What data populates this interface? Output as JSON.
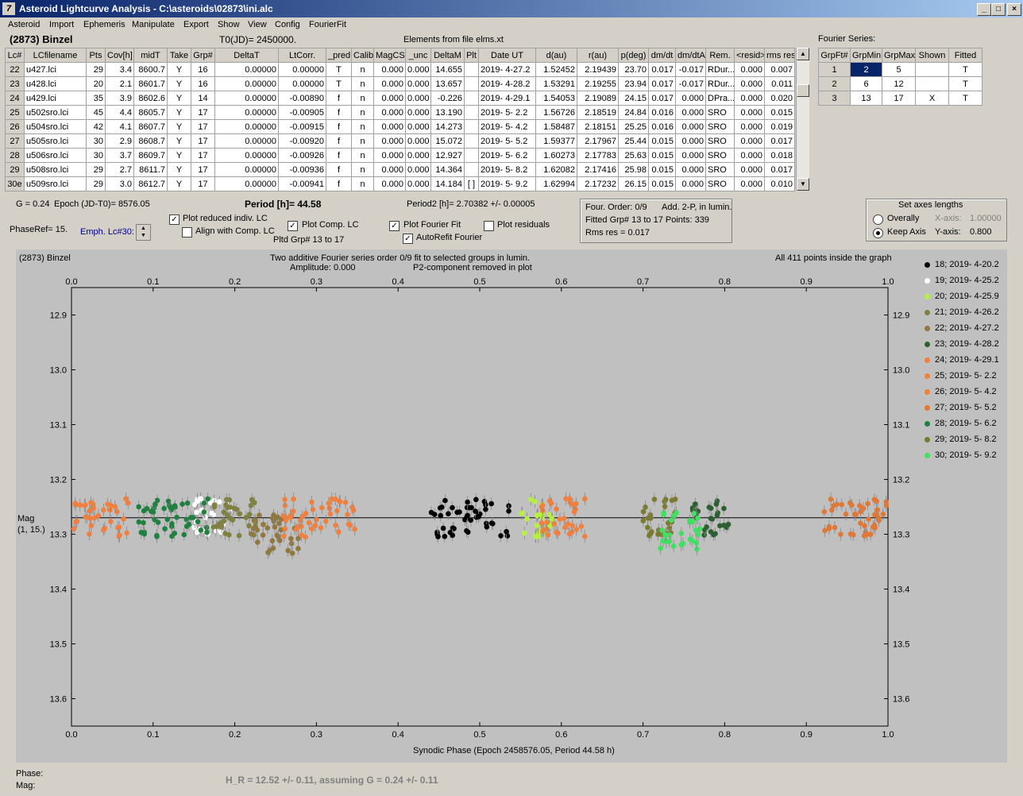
{
  "window": {
    "title": "Asteroid Lightcurve Analysis - C:\\asteroids\\02873\\ini.alc",
    "app_icon": "7"
  },
  "menu": [
    "Asteroid",
    "Import",
    "Ephemeris",
    "Manipulate",
    "Export",
    "Show",
    "View",
    "Config",
    "FourierFit"
  ],
  "header": {
    "asteroid": "(2873) Binzel",
    "t0": "T0(JD)= 2450000.",
    "elements": "Elements from file elms.xt",
    "fourier_label": "Fourier Series:"
  },
  "table": {
    "columns": [
      "Lc#",
      "LCfilename",
      "Pts",
      "Cov[h]",
      "midT",
      "Take",
      "Grp#",
      "DeltaT",
      "LtCorr.",
      "_pred.",
      "Calib.",
      "MagCS",
      "_unc",
      "DeltaM",
      "Plt",
      "Date UT",
      "d(au)",
      "r(au)",
      "p(deg)",
      "dm/dt",
      "dm/dtA",
      "Rem.",
      "<resid>",
      "rms res"
    ],
    "rows": [
      [
        "22",
        "u427.lci",
        "29",
        "3.4",
        "8600.7",
        "Y",
        "16",
        "0.00000",
        "0.00000",
        "T",
        "n",
        "0.000",
        "0.000",
        "14.655",
        "",
        "2019- 4-27.2",
        "1.52452",
        "2.19439",
        "23.70",
        "0.017",
        "-0.017",
        "RDur...",
        "0.000",
        "0.007"
      ],
      [
        "23",
        "u428.lci",
        "20",
        "2.1",
        "8601.7",
        "Y",
        "16",
        "0.00000",
        "0.00000",
        "T",
        "n",
        "0.000",
        "0.000",
        "13.657",
        "",
        "2019- 4-28.2",
        "1.53291",
        "2.19255",
        "23.94",
        "0.017",
        "-0.017",
        "RDur...",
        "0.000",
        "0.011"
      ],
      [
        "24",
        "u429.lci",
        "35",
        "3.9",
        "8602.6",
        "Y",
        "14",
        "0.00000",
        "-0.00890",
        "f",
        "n",
        "0.000",
        "0.000",
        "-0.226",
        "",
        "2019- 4-29.1",
        "1.54053",
        "2.19089",
        "24.15",
        "0.017",
        "0.000",
        "DPra...",
        "0.000",
        "0.020"
      ],
      [
        "25",
        "u502sro.lci",
        "45",
        "4.4",
        "8605.7",
        "Y",
        "17",
        "0.00000",
        "-0.00905",
        "f",
        "n",
        "0.000",
        "0.000",
        "13.190",
        "",
        "2019- 5- 2.2",
        "1.56726",
        "2.18519",
        "24.84",
        "0.016",
        "0.000",
        "SRO",
        "0.000",
        "0.015"
      ],
      [
        "26",
        "u504sro.lci",
        "42",
        "4.1",
        "8607.7",
        "Y",
        "17",
        "0.00000",
        "-0.00915",
        "f",
        "n",
        "0.000",
        "0.000",
        "14.273",
        "",
        "2019- 5- 4.2",
        "1.58487",
        "2.18151",
        "25.25",
        "0.016",
        "0.000",
        "SRO",
        "0.000",
        "0.019"
      ],
      [
        "27",
        "u505sro.lci",
        "30",
        "2.9",
        "8608.7",
        "Y",
        "17",
        "0.00000",
        "-0.00920",
        "f",
        "n",
        "0.000",
        "0.000",
        "15.072",
        "",
        "2019- 5- 5.2",
        "1.59377",
        "2.17967",
        "25.44",
        "0.015",
        "0.000",
        "SRO",
        "0.000",
        "0.017"
      ],
      [
        "28",
        "u506sro.lci",
        "30",
        "3.7",
        "8609.7",
        "Y",
        "17",
        "0.00000",
        "-0.00926",
        "f",
        "n",
        "0.000",
        "0.000",
        "12.927",
        "",
        "2019- 5- 6.2",
        "1.60273",
        "2.17783",
        "25.63",
        "0.015",
        "0.000",
        "SRO",
        "0.000",
        "0.018"
      ],
      [
        "29",
        "u508sro.lci",
        "29",
        "2.7",
        "8611.7",
        "Y",
        "17",
        "0.00000",
        "-0.00936",
        "f",
        "n",
        "0.000",
        "0.000",
        "14.364",
        "",
        "2019- 5- 8.2",
        "1.62082",
        "2.17416",
        "25.98",
        "0.015",
        "0.000",
        "SRO",
        "0.000",
        "0.017"
      ],
      [
        "30e",
        "u509sro.lci",
        "29",
        "3.0",
        "8612.7",
        "Y",
        "17",
        "0.00000",
        "-0.00941",
        "f",
        "n",
        "0.000",
        "0.000",
        "14.184",
        "[ ]",
        "2019- 5- 9.2",
        "1.62994",
        "2.17232",
        "26.15",
        "0.015",
        "0.000",
        "SRO",
        "0.000",
        "0.010"
      ]
    ]
  },
  "fourier_table": {
    "columns": [
      "GrpFt#",
      "GrpMin",
      "GrpMax",
      "Shown",
      "Fitted"
    ],
    "rows": [
      [
        "1",
        "2",
        "5",
        "",
        "T"
      ],
      [
        "2",
        "6",
        "12",
        "",
        "T"
      ],
      [
        "3",
        "13",
        "17",
        "X",
        "T"
      ]
    ]
  },
  "controls": {
    "g": "G = 0.24",
    "epoch": "Epoch (JD-T0)= 8576.05",
    "period": "Period [h]= 44.58",
    "period2": "Period2 [h]= 2.70382 +/- 0.00005",
    "phaseref": "PhaseRef= 15.",
    "emph": "Emph. Lc#30:",
    "plot_reduced": "Plot reduced indiv. LC",
    "align": "Align with Comp. LC",
    "plot_comp": "Plot Comp. LC",
    "pltd_grp": "Pltd Grp#  13 to   17",
    "plot_fourier": "Plot Fourier Fit",
    "autorefit": "AutoRefit Fourier",
    "plot_resid": "Plot residuals",
    "four_order": "Four. Order:  0/9",
    "add2p": "Add. 2-P, in lumin.",
    "fitted_grp": "Fitted Grp# 13 to 17 Points: 339",
    "rms": "Rms res      = 0.017",
    "axes_title": "Set axes lengths",
    "overally": "Overally",
    "keep_axis": "Keep Axis",
    "xaxis_label": "X-axis:",
    "xaxis_val": "1.00000",
    "yaxis_label": "Y-axis:",
    "yaxis_val": "0.800"
  },
  "plot": {
    "name": "(2873) Binzel",
    "line1": "Two additive Fourier series order 0/9 fit to selected groups in lumin.",
    "line2": "Amplitude: 0.000",
    "line3": "P2-component removed in plot",
    "points_note": "All 411 points inside the graph",
    "ylabel1": "Mag",
    "ylabel2": "(1, 15.)",
    "xlabel": "Synodic Phase (Epoch 2458576.05, Period 44.58 h)"
  },
  "chart_data": {
    "type": "scatter",
    "xlim": [
      0,
      1
    ],
    "ylim": [
      13.65,
      12.85
    ],
    "xticks": [
      "0.0",
      "0.1",
      "0.2",
      "0.3",
      "0.4",
      "0.5",
      "0.6",
      "0.7",
      "0.8",
      "0.9",
      "1.0"
    ],
    "yticks": [
      "12.9",
      "13.0",
      "13.1",
      "13.2",
      "13.3",
      "13.4",
      "13.5",
      "13.6"
    ],
    "fit_line_y": 13.27,
    "series": [
      {
        "name": "18; 2019- 4-20.2",
        "color": "#000000",
        "x_range": [
          0.44,
          0.54
        ]
      },
      {
        "name": "19; 2019- 4-25.2",
        "color": "#ffffff",
        "x_range": [
          0.15,
          0.2
        ]
      },
      {
        "name": "20; 2019- 4-25.9",
        "color": "#b8f040",
        "x_range": [
          0.55,
          0.59
        ]
      },
      {
        "name": "21; 2019- 4-26.2",
        "color": "#808040",
        "x_range": [
          0.17,
          0.23
        ]
      },
      {
        "name": "22; 2019- 4-27.2",
        "color": "#907840",
        "x_range": [
          0.22,
          0.28
        ]
      },
      {
        "name": "23; 2019- 4-28.2",
        "color": "#2c6030",
        "x_range": [
          0.76,
          0.81
        ]
      },
      {
        "name": "24; 2019- 4-29.1",
        "color": "#f08040",
        "x_range": [
          0.26,
          0.35
        ]
      },
      {
        "name": "25; 2019- 5- 2.2",
        "color": "#f08040",
        "x_range": [
          0.0,
          0.07
        ]
      },
      {
        "name": "26; 2019- 5- 4.2",
        "color": "#f08040",
        "x_range": [
          0.57,
          0.63
        ]
      },
      {
        "name": "27; 2019- 5- 5.2",
        "color": "#e07838",
        "x_range": [
          0.92,
          1.0
        ]
      },
      {
        "name": "28; 2019- 5- 6.2",
        "color": "#208040",
        "x_range": [
          0.08,
          0.17
        ]
      },
      {
        "name": "29; 2019- 5- 8.2",
        "color": "#7a7a30",
        "x_range": [
          0.7,
          0.74
        ]
      },
      {
        "name": "30; 2019- 5- 9.2",
        "color": "#40e060",
        "x_range": [
          0.72,
          0.77
        ]
      }
    ]
  },
  "footer": {
    "phase": "Phase:",
    "mag": "Mag:",
    "hr": "H_R = 12.52 +/- 0.11, assuming G = 0.24 +/- 0.11"
  }
}
